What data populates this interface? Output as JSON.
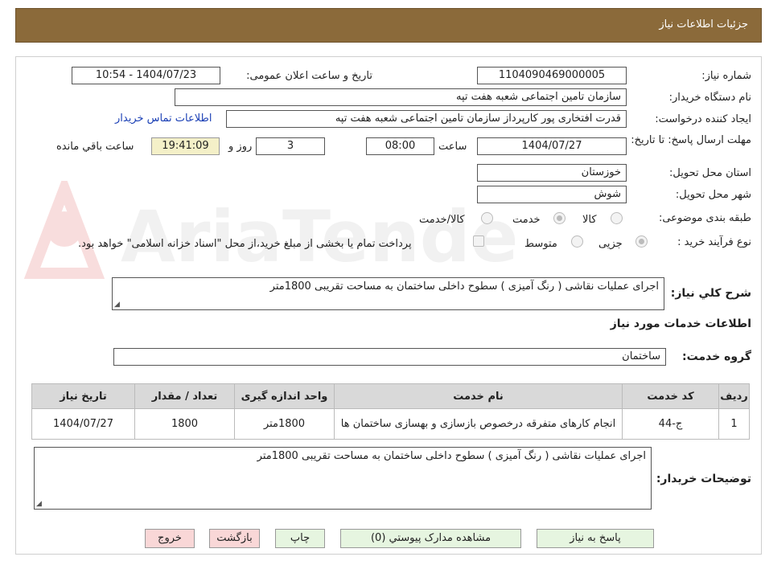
{
  "header": {
    "title": "جزئیات اطلاعات نیاز"
  },
  "form": {
    "need_number_label": "شماره نیاز:",
    "need_number_value": "1104090469000005",
    "announce_label": "تاریخ و ساعت اعلان عمومی:",
    "announce_value": "1404/07/23 - 10:54",
    "buyer_org_label": "نام دستگاه خریدار:",
    "buyer_org_value": "سازمان تامین اجتماعی شعبه هفت تپه",
    "requester_label": "ایجاد کننده درخواست:",
    "requester_value": "قدرت افتخاری پور کارپرداز سازمان تامین اجتماعی شعبه هفت تپه",
    "contact_link": "اطلاعات تماس خریدار",
    "deadline_label": "مهلت ارسال پاسخ: تا تاریخ:",
    "deadline_date": "1404/07/27",
    "time_label": "ساعت",
    "deadline_time": "08:00",
    "days_value": "3",
    "days_label": "روز و",
    "remaining_time": "19:41:09",
    "remaining_label": "ساعت باقي مانده",
    "province_label": "استان محل تحویل:",
    "province_value": "خوزستان",
    "city_label": "شهر محل تحویل:",
    "city_value": "شوش",
    "category_label": "طبقه بندی موضوعی:",
    "category_options": [
      "کالا",
      "خدمت",
      "کالا/خدمت"
    ],
    "category_selected": "خدمت",
    "process_label": "نوع فرآیند خرید :",
    "process_options": [
      "جزیی",
      "متوسط"
    ],
    "process_selected": "جزیی",
    "payment_note": "پرداخت تمام یا بخشی از مبلغ خرید،از محل \"اسناد خزانه اسلامی\" خواهد بود.",
    "description_label": "شرح کلي نياز:",
    "description_value": "اجرای عملیات نقاشی ( رنگ آمیزی ) سطوح داخلی ساختمان به مساحت تقریبی 1800متر",
    "services_heading": "اطلاعات خدمات مورد نیاز",
    "service_group_label": "گروه خدمت:",
    "service_group_value": "ساختمان",
    "buyer_notes_label": "توضیحات خریدار:",
    "buyer_notes_value": "اجرای عملیات نقاشی ( رنگ آمیزی ) سطوح داخلی ساختمان به مساحت تقریبی 1800متر"
  },
  "table": {
    "headers": [
      "ردیف",
      "کد خدمت",
      "نام خدمت",
      "واحد اندازه گیری",
      "تعداد / مقدار",
      "تاریخ نیاز"
    ],
    "rows": [
      [
        "1",
        "ج-44",
        "انجام کارهای متفرقه درخصوص بازسازی و بهسازی ساختمان ها",
        "1800متر",
        "1800",
        "1404/07/27"
      ]
    ]
  },
  "buttons": {
    "reply": "پاسخ به نیاز",
    "attachments": "مشاهده مدارک پیوستي (0)",
    "print": "چاپ",
    "back": "بازگشت",
    "exit": "خروج"
  },
  "watermark": {
    "text": "AriaTender.neT"
  },
  "colors": {
    "header_bg": "#8b6a3a",
    "link": "#1a3fb5",
    "timer_bg": "#f4f0c8",
    "green_btn": "#e6f5e0",
    "pink_btn": "#f9d7d7"
  }
}
